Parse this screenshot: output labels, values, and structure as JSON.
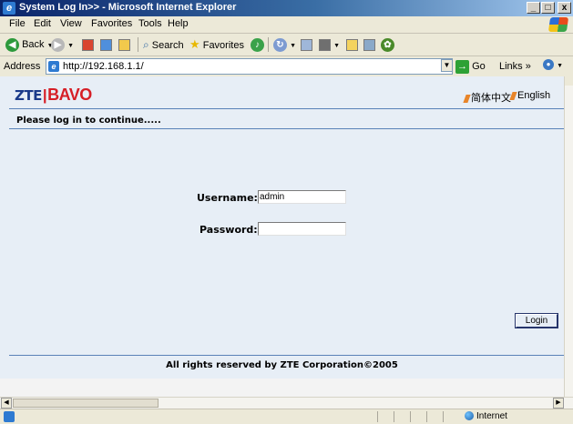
{
  "window": {
    "title": "System Log In>> - Microsoft Internet Explorer",
    "minimize": "_",
    "restore": "□",
    "close": "x"
  },
  "menu": {
    "items": [
      "File",
      "Edit",
      "View",
      "Favorites",
      "Tools",
      "Help"
    ]
  },
  "toolbar": {
    "back_label": "Back",
    "search_label": "Search",
    "favorites_label": "Favorites"
  },
  "address": {
    "label": "Address",
    "url": "http://192.168.1.1/",
    "go_label": "Go",
    "links_label": "Links »"
  },
  "page": {
    "logo_zte": "ZTE",
    "logo_divider": "|",
    "logo_bavo": "BAVO",
    "lang_chinese": "简体中文",
    "lang_english": "English",
    "prompt": "Please log in to continue.....",
    "username_label": "Username:",
    "username_value": "admin",
    "password_label": "Password:",
    "password_value": "",
    "login_button": "Login",
    "footer": "All rights reserved by ZTE Corporation©2005"
  },
  "status": {
    "zone": "Internet"
  },
  "colors": {
    "content_bg": "#e7eef6",
    "divider": "#5a82b8",
    "logo_blue": "#1a3a8a",
    "logo_red": "#d61e26",
    "lang_flag": "#e8852a"
  }
}
